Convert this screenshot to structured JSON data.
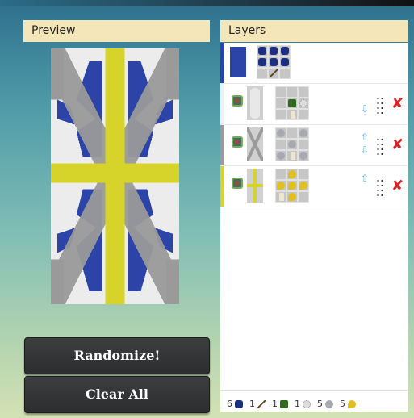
{
  "preview": {
    "title": "Preview",
    "base_color": "#2c44a8",
    "pattern_colors": {
      "white": "#ececec",
      "gray": "#9a9a9a",
      "yellow": "#d6d42a",
      "blue": "#2c44a8"
    }
  },
  "buttons": {
    "randomize": "Randomize!",
    "clear_all": "Clear All"
  },
  "layers": {
    "title": "Layers",
    "rows": [
      {
        "color": "#2c44a8",
        "type": "base",
        "recipe": [
          "blue-wool",
          "blue-wool",
          "blue-wool",
          "blue-wool",
          "blue-wool",
          "blue-wool",
          "",
          "stick",
          ""
        ]
      },
      {
        "color": "#f0f0f0",
        "type": "flower-border",
        "recipe": [
          "",
          "",
          "",
          "",
          "fern",
          "oxeye-daisy",
          "",
          "banner",
          ""
        ],
        "can_up": false,
        "can_down": true
      },
      {
        "color": "#9a9a9a",
        "type": "cross",
        "recipe": [
          "gray-dye",
          "",
          "gray-dye",
          "",
          "gray-dye",
          "",
          "gray-dye",
          "banner",
          "gray-dye"
        ],
        "can_up": true,
        "can_down": true
      },
      {
        "color": "#d6d42a",
        "type": "straight-cross",
        "recipe": [
          "",
          "yellow-dye",
          "",
          "yellow-dye",
          "yellow-dye",
          "yellow-dye",
          "banner",
          "yellow-dye",
          ""
        ],
        "can_up": true,
        "can_down": false
      }
    ]
  },
  "materials": [
    {
      "count": "6",
      "item": "blue-wool"
    },
    {
      "count": "1",
      "item": "stick"
    },
    {
      "count": "1",
      "item": "fern"
    },
    {
      "count": "1",
      "item": "oxeye-daisy"
    },
    {
      "count": "5",
      "item": "gray-dye"
    },
    {
      "count": "5",
      "item": "yellow-dye"
    }
  ]
}
